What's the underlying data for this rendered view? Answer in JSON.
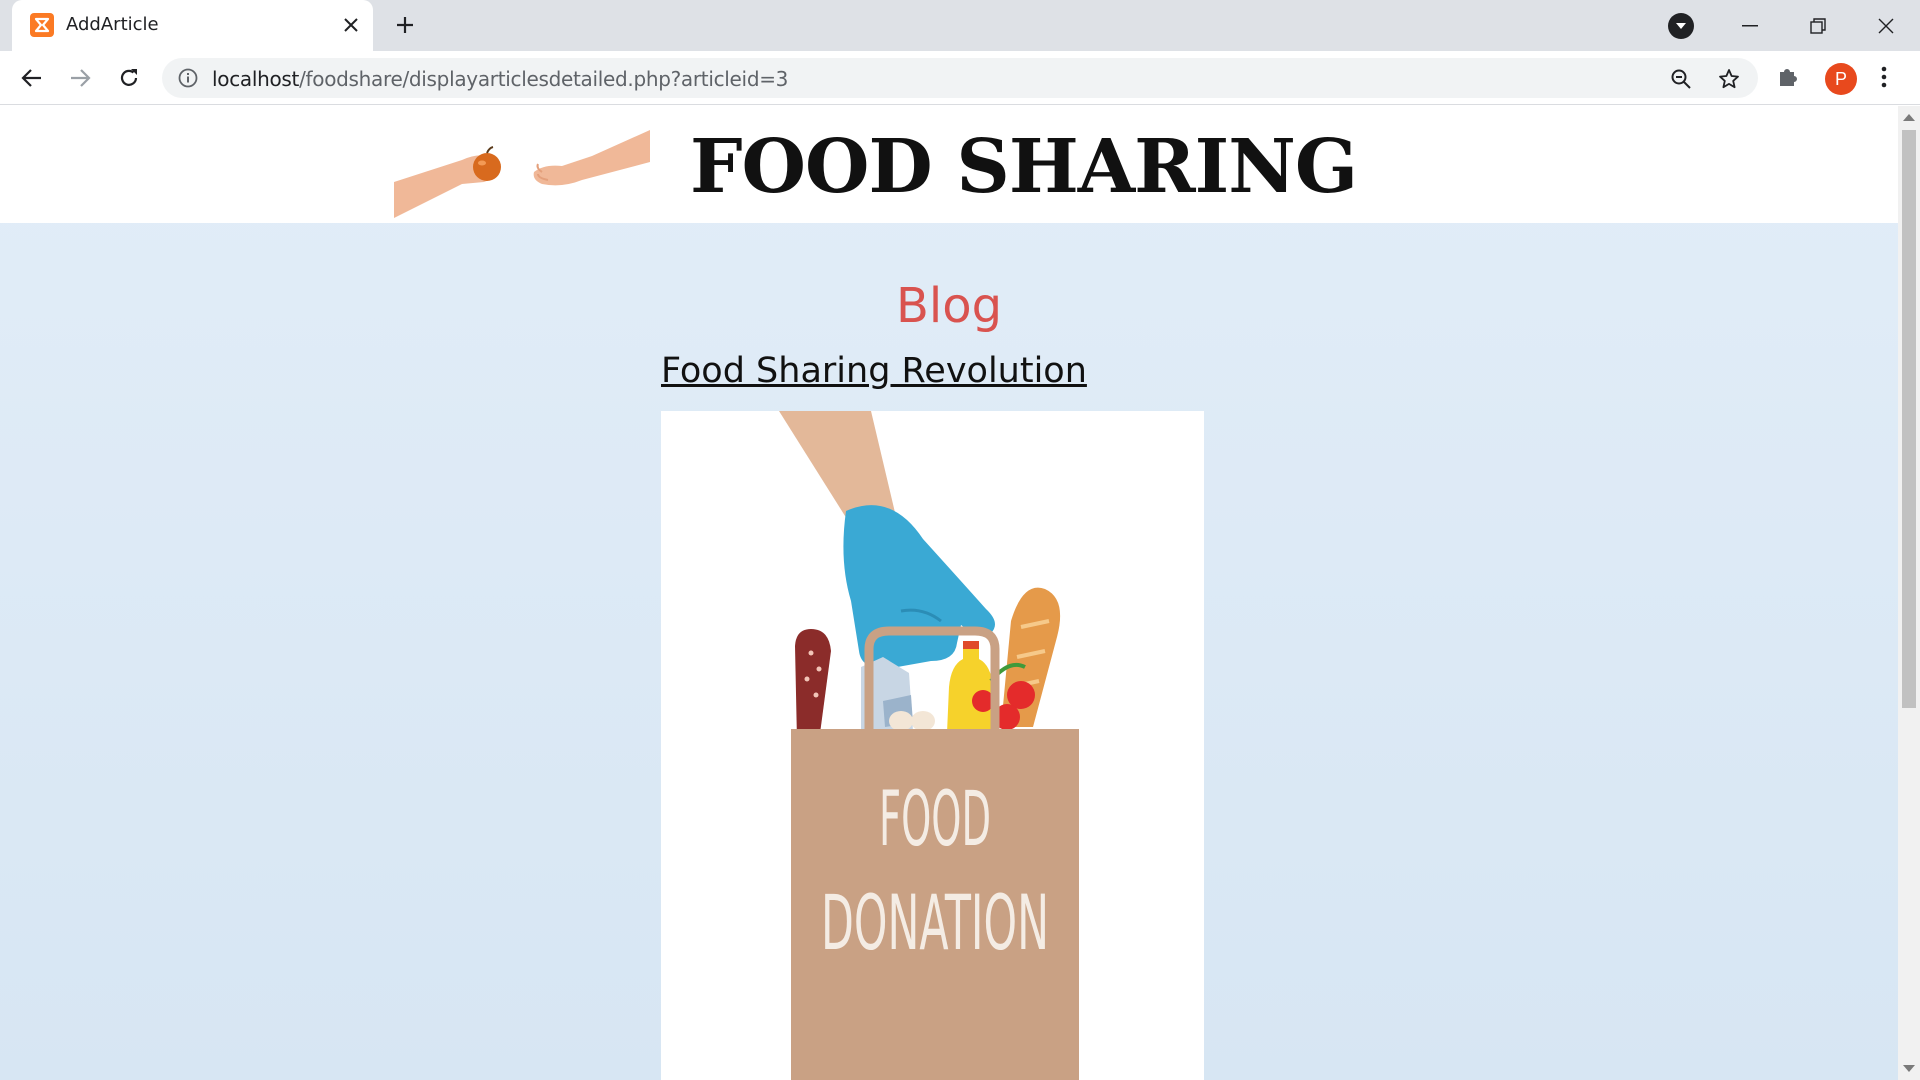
{
  "browser": {
    "tab_title": "AddArticle",
    "url_host": "localhost",
    "url_path": "/foodshare/displayarticlesdetailed.php?articleid=3",
    "profile_initial": "P"
  },
  "page": {
    "site_title": "FOOD SHARING",
    "section_heading": "Blog",
    "article_title": "Food Sharing Revolution",
    "image_text_line1": "FOOD",
    "image_text_line2": "DONATION"
  },
  "colors": {
    "accent_heading": "#d9534f",
    "page_background": "#e2edf8",
    "bag": "#c9a184",
    "glove": "#3aa9d4"
  }
}
